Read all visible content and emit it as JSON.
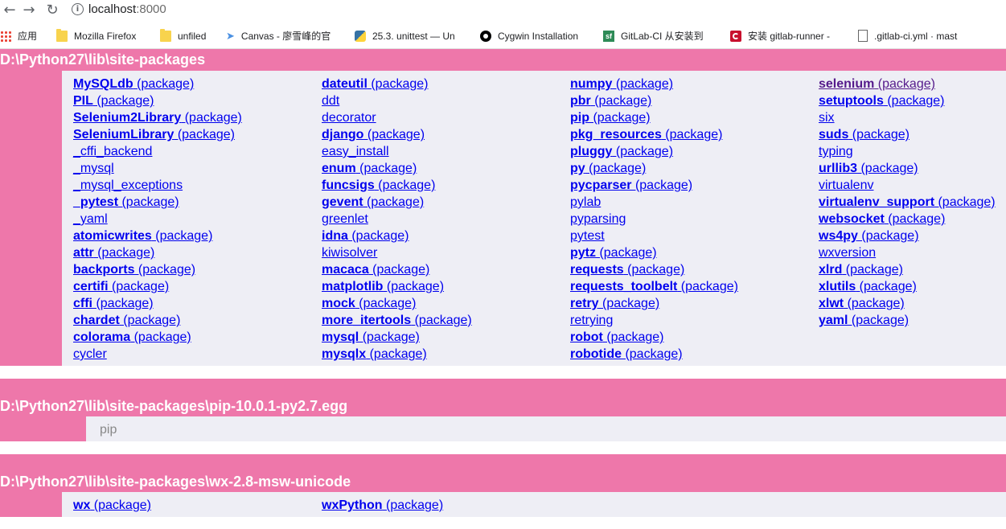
{
  "browser": {
    "url_host": "localhost",
    "url_port": ":8000",
    "back_icon": "arrow-left",
    "forward_icon": "arrow-right",
    "reload_icon": "reload",
    "info_icon": "info"
  },
  "bookmarks": [
    {
      "label": "应用",
      "icon": "apps-grid"
    },
    {
      "label": "Mozilla Firefox",
      "icon": "folder"
    },
    {
      "label": "unfiled",
      "icon": "folder"
    },
    {
      "label": "Canvas - 廖雪峰的官",
      "icon": "rocket"
    },
    {
      "label": "25.3. unittest — Un",
      "icon": "python-logo"
    },
    {
      "label": "Cygwin Installation",
      "icon": "cygwin-logo"
    },
    {
      "label": "GitLab-CI 从安装到",
      "icon": "sf-logo"
    },
    {
      "label": "安装 gitlab-runner -",
      "icon": "c-logo"
    },
    {
      "label": ".gitlab-ci.yml · mast",
      "icon": "document"
    }
  ],
  "colors": {
    "header": "#ee77aa",
    "body": "#eeeef5",
    "link": "#0000ee",
    "visited": "#551a8b"
  },
  "sections": [
    {
      "title": "D:\\Python27\\lib\\site-packages",
      "columns": [
        [
          {
            "name": "MySQLdb",
            "suffix": " (package)"
          },
          {
            "name": "PIL",
            "suffix": " (package)"
          },
          {
            "name": "Selenium2Library",
            "suffix": " (package)"
          },
          {
            "name": "SeleniumLibrary",
            "suffix": " (package)"
          },
          {
            "name": "_cffi_backend",
            "suffix": ""
          },
          {
            "name": "_mysql",
            "suffix": ""
          },
          {
            "name": "_mysql_exceptions",
            "suffix": ""
          },
          {
            "name": "_pytest",
            "suffix": " (package)"
          },
          {
            "name": "_yaml",
            "suffix": ""
          },
          {
            "name": "atomicwrites",
            "suffix": " (package)"
          },
          {
            "name": "attr",
            "suffix": " (package)"
          },
          {
            "name": "backports",
            "suffix": " (package)"
          },
          {
            "name": "certifi",
            "suffix": " (package)"
          },
          {
            "name": "cffi",
            "suffix": " (package)"
          },
          {
            "name": "chardet",
            "suffix": " (package)"
          },
          {
            "name": "colorama",
            "suffix": " (package)"
          },
          {
            "name": "cycler",
            "suffix": ""
          }
        ],
        [
          {
            "name": "dateutil",
            "suffix": " (package)"
          },
          {
            "name": "ddt",
            "suffix": ""
          },
          {
            "name": "decorator",
            "suffix": ""
          },
          {
            "name": "django",
            "suffix": " (package)"
          },
          {
            "name": "easy_install",
            "suffix": ""
          },
          {
            "name": "enum",
            "suffix": " (package)"
          },
          {
            "name": "funcsigs",
            "suffix": " (package)"
          },
          {
            "name": "gevent",
            "suffix": " (package)"
          },
          {
            "name": "greenlet",
            "suffix": ""
          },
          {
            "name": "idna",
            "suffix": " (package)"
          },
          {
            "name": "kiwisolver",
            "suffix": ""
          },
          {
            "name": "macaca",
            "suffix": " (package)"
          },
          {
            "name": "matplotlib",
            "suffix": " (package)"
          },
          {
            "name": "mock",
            "suffix": " (package)"
          },
          {
            "name": "more_itertools",
            "suffix": " (package)"
          },
          {
            "name": "mysql",
            "suffix": " (package)"
          },
          {
            "name": "mysqlx",
            "suffix": " (package)"
          }
        ],
        [
          {
            "name": "numpy",
            "suffix": " (package)"
          },
          {
            "name": "pbr",
            "suffix": " (package)"
          },
          {
            "name": "pip",
            "suffix": " (package)"
          },
          {
            "name": "pkg_resources",
            "suffix": " (package)"
          },
          {
            "name": "pluggy",
            "suffix": " (package)"
          },
          {
            "name": "py",
            "suffix": " (package)"
          },
          {
            "name": "pycparser",
            "suffix": " (package)"
          },
          {
            "name": "pylab",
            "suffix": ""
          },
          {
            "name": "pyparsing",
            "suffix": ""
          },
          {
            "name": "pytest",
            "suffix": ""
          },
          {
            "name": "pytz",
            "suffix": " (package)"
          },
          {
            "name": "requests",
            "suffix": " (package)"
          },
          {
            "name": "requests_toolbelt",
            "suffix": " (package)"
          },
          {
            "name": "retry",
            "suffix": " (package)"
          },
          {
            "name": "retrying",
            "suffix": ""
          },
          {
            "name": "robot",
            "suffix": " (package)"
          },
          {
            "name": "robotide",
            "suffix": " (package)"
          }
        ],
        [
          {
            "name": "selenium",
            "suffix": " (package)",
            "visited": true
          },
          {
            "name": "setuptools",
            "suffix": " (package)"
          },
          {
            "name": "six",
            "suffix": ""
          },
          {
            "name": "suds",
            "suffix": " (package)"
          },
          {
            "name": "typing",
            "suffix": ""
          },
          {
            "name": "urllib3",
            "suffix": " (package)"
          },
          {
            "name": "virtualenv",
            "suffix": ""
          },
          {
            "name": "virtualenv_support",
            "suffix": " (package)"
          },
          {
            "name": "websocket",
            "suffix": " (package)"
          },
          {
            "name": "ws4py",
            "suffix": " (package)"
          },
          {
            "name": "wxversion",
            "suffix": ""
          },
          {
            "name": "xlrd",
            "suffix": " (package)"
          },
          {
            "name": "xlutils",
            "suffix": " (package)"
          },
          {
            "name": "xlwt",
            "suffix": " (package)"
          },
          {
            "name": "yaml",
            "suffix": " (package)"
          }
        ]
      ]
    },
    {
      "title": "D:\\Python27\\lib\\site-packages\\pip-10.0.1-py2.7.egg",
      "items": [
        "pip"
      ]
    },
    {
      "title": "D:\\Python27\\lib\\site-packages\\wx-2.8-msw-unicode",
      "columns": [
        [
          {
            "name": "wx",
            "suffix": " (package)"
          }
        ],
        [
          {
            "name": "wxPython",
            "suffix": " (package)"
          }
        ]
      ]
    }
  ]
}
